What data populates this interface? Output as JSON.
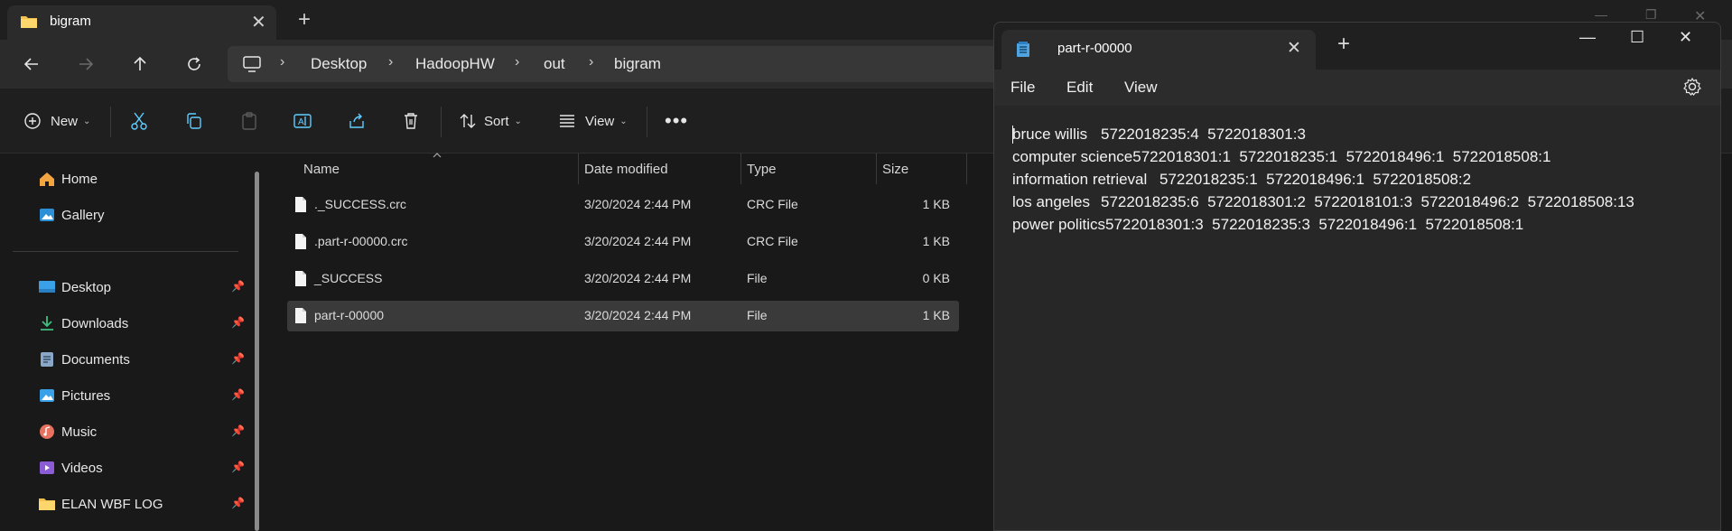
{
  "explorer": {
    "tab_title": "bigram",
    "breadcrumb": [
      "Desktop",
      "HadoopHW",
      "out",
      "bigram"
    ],
    "toolbar": {
      "new_label": "New",
      "sort_label": "Sort",
      "view_label": "View"
    },
    "sidebar": {
      "top_items": [
        {
          "label": "Home",
          "icon": "home-icon"
        },
        {
          "label": "Gallery",
          "icon": "gallery-icon"
        }
      ],
      "pinned_items": [
        {
          "label": "Desktop",
          "icon": "desktop-icon"
        },
        {
          "label": "Downloads",
          "icon": "downloads-icon"
        },
        {
          "label": "Documents",
          "icon": "documents-icon"
        },
        {
          "label": "Pictures",
          "icon": "pictures-icon"
        },
        {
          "label": "Music",
          "icon": "music-icon"
        },
        {
          "label": "Videos",
          "icon": "videos-icon"
        },
        {
          "label": "ELAN WBF LOG",
          "icon": "folder-icon"
        }
      ]
    },
    "columns": {
      "name": "Name",
      "date": "Date modified",
      "type": "Type",
      "size": "Size"
    },
    "files": [
      {
        "name": "._SUCCESS.crc",
        "date": "3/20/2024 2:44 PM",
        "type": "CRC File",
        "size": "1 KB"
      },
      {
        "name": ".part-r-00000.crc",
        "date": "3/20/2024 2:44 PM",
        "type": "CRC File",
        "size": "1 KB"
      },
      {
        "name": "_SUCCESS",
        "date": "3/20/2024 2:44 PM",
        "type": "File",
        "size": "0 KB"
      },
      {
        "name": "part-r-00000",
        "date": "3/20/2024 2:44 PM",
        "type": "File",
        "size": "1 KB"
      }
    ],
    "selected_file": "part-r-00000"
  },
  "notepad": {
    "tab_title": "part-r-00000",
    "menu": {
      "file": "File",
      "edit": "Edit",
      "view": "View"
    },
    "lines": [
      "bruce willis\t5722018235:4  5722018301:3",
      "computer science\t5722018301:1  5722018235:1  5722018496:1  5722018508:1",
      "information retrieval\t5722018235:1  5722018496:1  5722018508:2",
      "los angeles\t5722018235:6  5722018301:2  5722018101:3  5722018496:2  5722018508:13",
      "power politics\t5722018301:3  5722018235:3  5722018496:1  5722018508:1"
    ]
  },
  "colors": {
    "accent": "#60cdff",
    "folder": "#f2c14e",
    "selected_row": "#3a3a3a"
  }
}
